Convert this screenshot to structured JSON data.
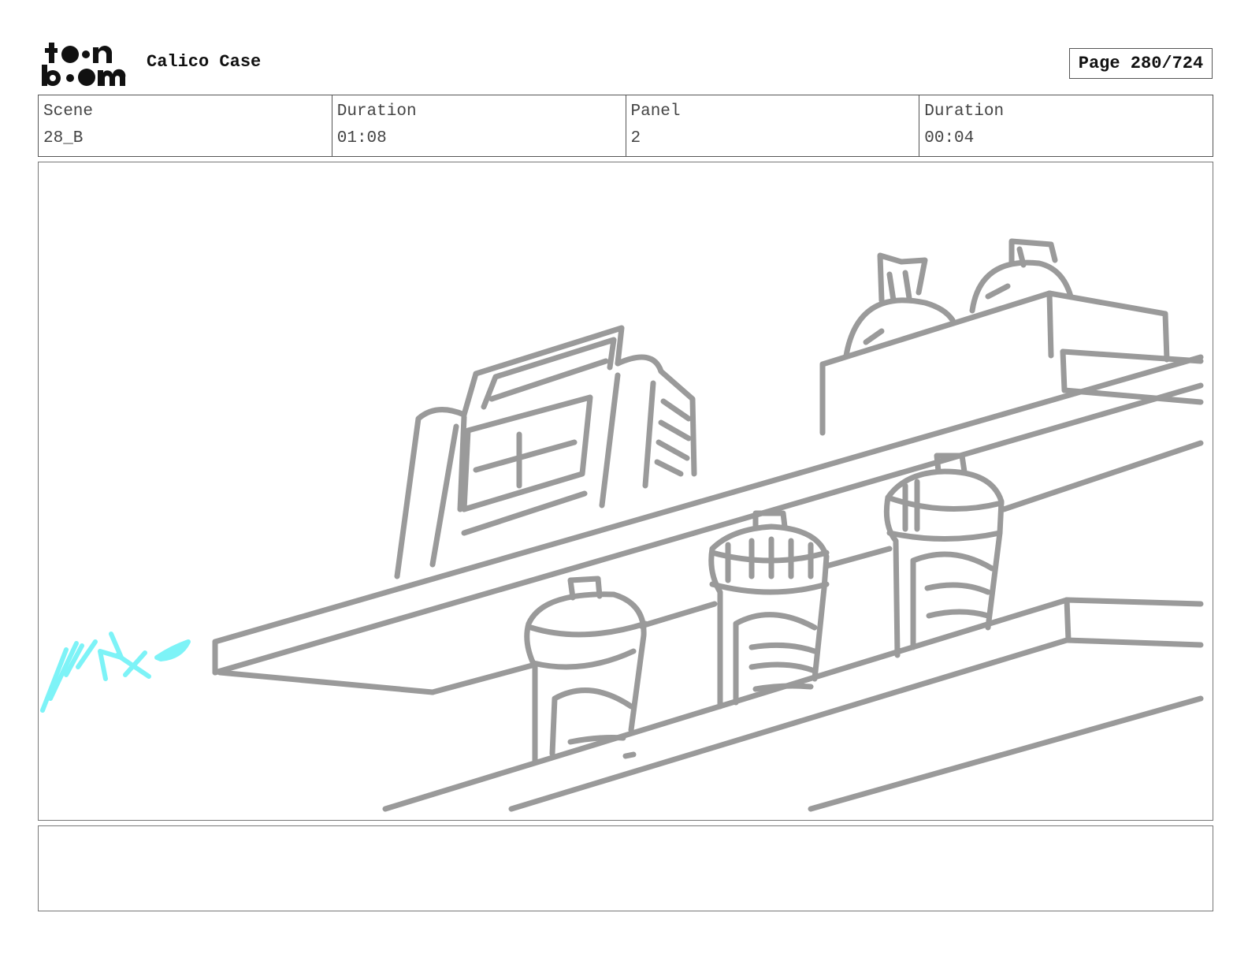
{
  "header": {
    "logo_text": "toon boom",
    "project_title": "Calico Case",
    "page_label": "Page 280/724"
  },
  "info": {
    "scene_label": "Scene",
    "scene_value": "28_B",
    "scene_duration_label": "Duration",
    "scene_duration_value": "01:08",
    "panel_label": "Panel",
    "panel_value": "2",
    "panel_duration_label": "Duration",
    "panel_duration_value": "00:04"
  },
  "colors": {
    "sketch_gray": "#9a9a9a",
    "effect_cyan": "#7df3f7"
  },
  "notes": {
    "text": ""
  }
}
